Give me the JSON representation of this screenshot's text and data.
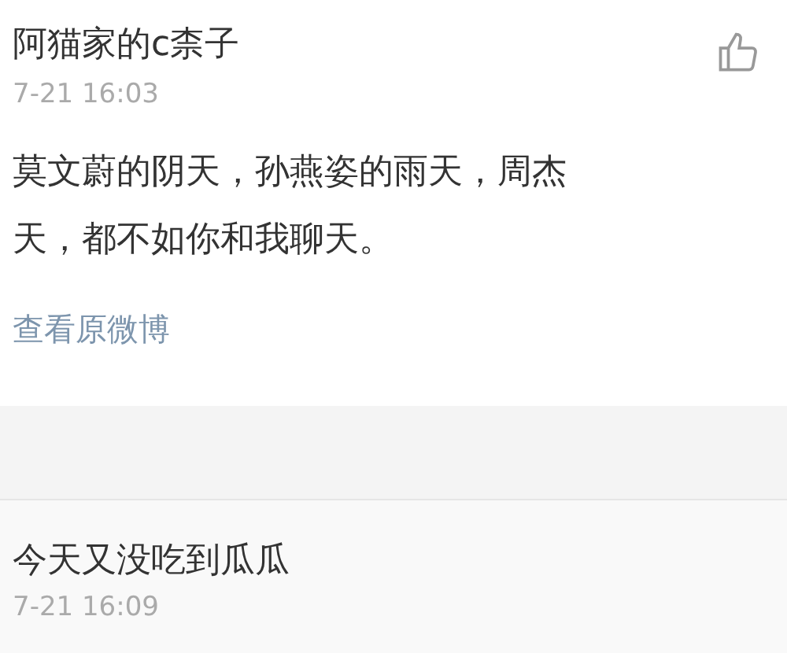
{
  "comments": [
    {
      "author": "阿猫家的c柰子",
      "time": "7-21 16:03",
      "text_lines": [
        "莫文蔚的阴天，孙燕姿的雨天，周杰",
        "天，都不如你和我聊天。"
      ],
      "link": "查看原微博"
    },
    {
      "author": "今天又没吃到瓜瓜",
      "time": "7-21 16:09"
    }
  ]
}
